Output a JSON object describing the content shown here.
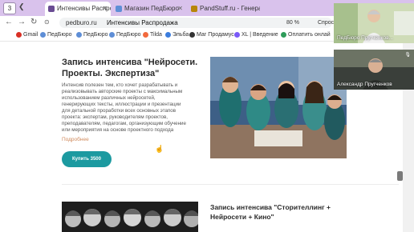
{
  "browser": {
    "tab_count": "3",
    "tabs": [
      {
        "label": "Интенсивы Распродажа",
        "active": true,
        "color": "#6a4c93"
      },
      {
        "label": "Магазин ПедБюро",
        "active": false,
        "color": "#5e8ed6"
      },
      {
        "label": "PandStuff.ru - Генерато",
        "active": false,
        "color": "#3b3b3b"
      }
    ],
    "url_domain": "pedburo.ru",
    "page_title": "Интенсивы Распродажа",
    "zoom": "80 %",
    "ask": "Спросить",
    "bookmarks": [
      "Gmail",
      "ПедБюро",
      "ПедБюро",
      "ПедБюро",
      "Tilda",
      "Эльба",
      "Маг Продамус",
      "XL | Введение",
      "Оплатить онлай"
    ]
  },
  "main": {
    "title": "Запись интенсива \"Нейросети. Проекты. Экспертиза\"",
    "description": "Интенсив полезен тем, кто хочет разрабатывать и реализовывать авторские проекты с максимальным использованием различных нейросетей, генерирующих тексты, иллюстрации и презентации для детальной проработки всех основных этапов проекта: экспертам, руководителям проектов, преподавателям, педагогам, организующим обучение или мероприятия на основе проектного подхода",
    "more_link": "Подробнее",
    "buy_button": "Купить 3500",
    "second_title": "Запись интенсива \"Сторителлинг + Нейросети + Кино\""
  },
  "participants": [
    {
      "name": "ПедБюро Пругченков...",
      "accent": "#d6e3c4"
    },
    {
      "name": "Александр Пругченков",
      "accent": "#3a3f3a"
    }
  ],
  "colors": {
    "accent": "#1c9aa0",
    "link": "#d08a5c",
    "tabbar": "#d9c2ec"
  }
}
